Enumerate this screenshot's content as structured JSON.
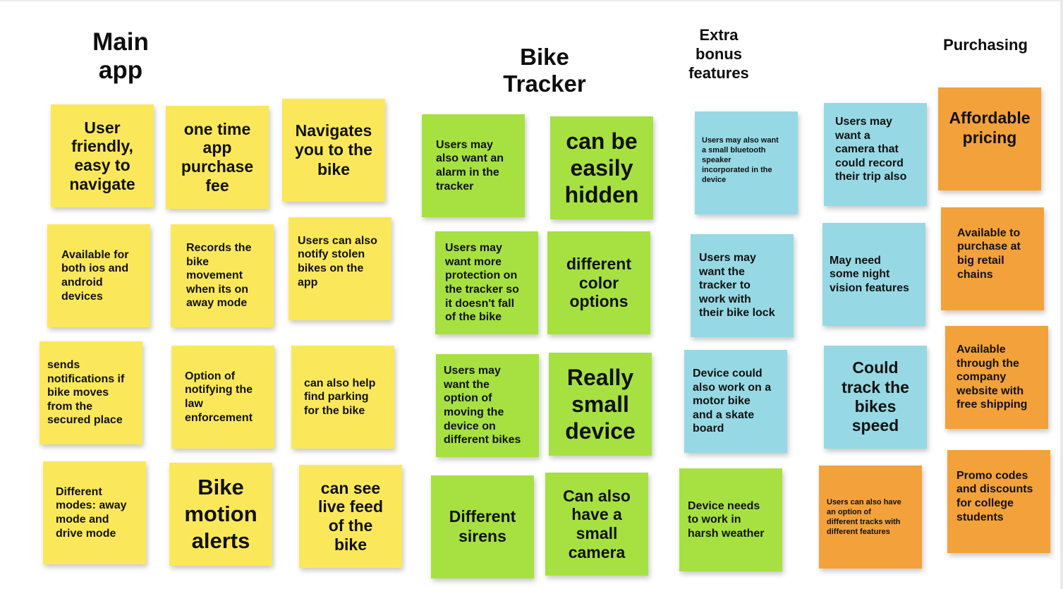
{
  "board": {
    "columns": {
      "main_app": "Main\napp",
      "bike_tracker": "Bike\nTracker",
      "extra_bonus": "Extra\nbonus\nfeatures",
      "purchasing": "Purchasing"
    },
    "colors": {
      "yellow": "#fbe85a",
      "green": "#a6e141",
      "blue": "#96d9e5",
      "orange": "#f3a13b"
    },
    "notes": {
      "user_friendly": "User\nfriendly,\neasy to\nnavigate",
      "one_time_fee": "one time\napp\npurchase\nfee",
      "navigates": "Navigates\nyou to the\nbike",
      "ios_android": "Available for\nboth ios and\nandroid\ndevices",
      "records_movement": "Records the\nbike\nmovement\nwhen its on\naway mode",
      "notify_stolen": "Users can also\nnotify stolen\nbikes on the\napp",
      "sends_notifications": "sends\nnotifications if\nbike moves\nfrom the\nsecured place",
      "notify_law": "Option of\nnotifying the\nlaw\nenforcement",
      "find_parking": "can also help\nfind parking\nfor the bike",
      "modes": "Different\nmodes: away\nmode and\ndrive mode",
      "motion_alerts": "Bike\nmotion\nalerts",
      "live_feed": "can see\nlive feed\nof the\nbike",
      "alarm": "Users may\nalso want an\nalarm in the\ntracker",
      "easily_hidden": "can be\neasily\nhidden",
      "protection": "Users may\nwant more\nprotection on\nthe tracker so\nit doesn't fall\nof the bike",
      "color_options": "different\ncolor\noptions",
      "moving_device": "Users may\nwant the\noption of\nmoving the\ndevice on\ndifferent bikes",
      "small_device": "Really\nsmall\ndevice",
      "sirens": "Different\nsirens",
      "small_camera": "Can also\nhave a\nsmall\ncamera",
      "bluetooth_speaker": "Users may also want\na small bluetooth\nspeaker\nincorporated in the\ndevice",
      "bike_lock": "Users may\nwant the\ntracker to\nwork with\ntheir bike lock",
      "motor_bike": "Device could\nalso work on a\nmotor bike\nand a skate\nboard",
      "harsh_weather": "Device needs\nto work in\nharsh weather",
      "record_trip": "Users may\nwant a\ncamera that\ncould record\ntheir trip also",
      "night_vision": "May need\nsome night\nvision features",
      "track_speed": "Could\ntrack the\nbikes\nspeed",
      "different_tracks": "Users can also have\nan option of\ndifferent tracks with\ndifferent features",
      "affordable": "Affordable\npricing",
      "retail_chains": "Available to\npurchase at\nbig retail\nchains",
      "company_website": "Available\nthrough the\ncompany\nwebsite with\nfree shipping",
      "promo_codes": "Promo codes\nand discounts\nfor college\nstudents"
    }
  }
}
